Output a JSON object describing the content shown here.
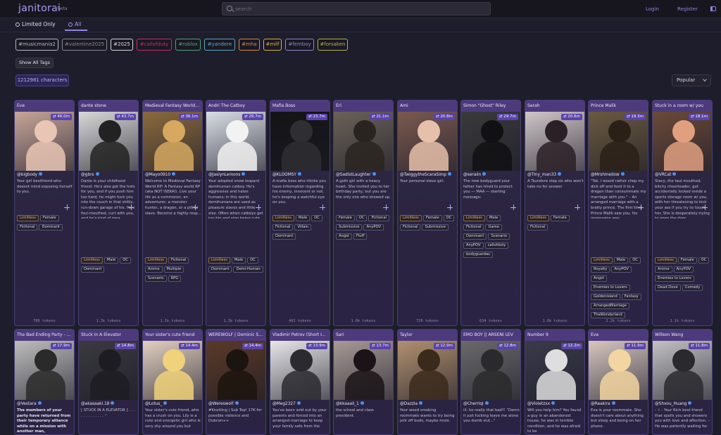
{
  "header": {
    "logo": "janitorai",
    "beta": "beta",
    "search_placeholder": "search",
    "login": "Login",
    "register": "Register"
  },
  "filters": {
    "limited_only": "Limited Only",
    "all": "All"
  },
  "tags": [
    {
      "label": "#musicmania2",
      "color": "#b9b6c9"
    },
    {
      "label": "#valentine2025",
      "color": "#8b8896"
    },
    {
      "label": "#2025",
      "color": "#d8d6e3"
    },
    {
      "label": "#callofduty",
      "color": "#c0306d"
    },
    {
      "label": "#roblox",
      "color": "#58a07a"
    },
    {
      "label": "#yandere",
      "color": "#5fa7c7"
    },
    {
      "label": "#mha",
      "color": "#d28c45"
    },
    {
      "label": "#milf",
      "color": "#d6b04a"
    },
    {
      "label": "#femboy",
      "color": "#8e86c9"
    },
    {
      "label": "#forsaken",
      "color": "#b8b33e"
    }
  ],
  "show_all_tags": "Show All Tags",
  "character_count": "1212981 characters",
  "sort": "Popular",
  "cards": [
    {
      "title": "Eve",
      "stat": "46.0m",
      "creator": "@bigbody",
      "desc": "Your girl bestfriend who doesnt mind exposing herself to you.",
      "tags": [
        "Limitless",
        "Female",
        "Fictional",
        "Dominant"
      ],
      "tokens": "789 tokens",
      "bg": "#c7a599",
      "fg": "#e9c5b5"
    },
    {
      "title": "dante stone",
      "stat": "43.7m",
      "creator": "@gbrs",
      "desc": "Dante is your childhood friend. He's also got the hots for you, and if you push him too hard, he might fuck you into the couch in that shitty, run-down garage of his. He's foul-mouthed, curt with you, and he's kind of mea...",
      "tags": [
        "Limitless",
        "Male",
        "OC",
        "Dominant"
      ],
      "tokens": "1.3k tokens",
      "bg": "#d8d8d8",
      "fg": "#222222"
    },
    {
      "title": "Medieval Fantasy World ...",
      "stat": "36.1m",
      "creator": "@Mayo0910",
      "desc": "Welcome to Medieval Fantasy World RP! A Fantasy world RP (aka NOT ISEKAI). Live your life as a commoner, an adventurer, a monster hunter, a dragon, or a pitiful slave. Become a highly resp...",
      "tags": [
        "Limitless",
        "Fictional",
        "Anime",
        "Multiple",
        "Scenario",
        "RPG"
      ],
      "tokens": "1.1k tokens",
      "bg": "#8a6a3e",
      "fg": "#d6a860"
    },
    {
      "title": "Andri The Catboy",
      "stat": "29.7m",
      "creator": "@JaslynLemons",
      "desc": "Your adopted snow leopard demihuman catboy. He's aggressive and hates humans; in this world, demihumans are used as pleasure slaves and little else. Often when catboys get too big and stop being cute, their owners abandon ...",
      "tags": [
        "Limitless",
        "Male",
        "OC",
        "Dominant",
        "Demi-Human"
      ],
      "tokens": "1.3k tokens",
      "bg": "#d9dee4",
      "fg": "#f2f2f2"
    },
    {
      "title": "Mafia Boss",
      "stat": "23.7m",
      "creator": "@KLOOMSY",
      "desc": "A mafia boss who thinks you have information regarding his enemy, innocent or not, he's keeping a watchful eye on you.",
      "tags": [
        "Limitless",
        "Male",
        "OC",
        "Fictional",
        "Villain",
        "Dominant"
      ],
      "tokens": "462 tokens",
      "bg": "#141416",
      "fg": "#2e2e33"
    },
    {
      "title": "Eri",
      "stat": "21.1m",
      "creator": "@SadistLaughter",
      "desc": "A goth girl with a heavy heart. She invited you to her birthday party, but you are the only one who showed up.",
      "tags": [
        "Female",
        "OC",
        "Fictional",
        "Submissive",
        "AnyPOV",
        "Angst",
        "Fluff"
      ],
      "tokens": "1.0k tokens",
      "bg": "#6a6258",
      "fg": "#2a2420"
    },
    {
      "title": "Ami",
      "stat": "20.8m",
      "creator": "@TwiggytheScaraSimp",
      "desc": "Your personal slave girl.",
      "tags": [
        "Limitless",
        "Female",
        "OC",
        "Fictional",
        "Submissive"
      ],
      "tokens": "720 tokens",
      "bg": "#7a5a50",
      "fg": "#e6c0aa"
    },
    {
      "title": "Simon \"Ghost\" Riley",
      "stat": "29.7m",
      "creator": "@seraiin",
      "desc": "The new bodyguard your father has hired to protect you — MAA — starting message:",
      "tags": [
        "Limitless",
        "Male",
        "Fictional",
        "Game",
        "Dominant",
        "Scenario",
        "AnyPOV",
        "callofduty",
        "bodyguardau"
      ],
      "tokens": "634 tokens",
      "bg": "#3a3a3c",
      "fg": "#111113"
    },
    {
      "title": "Sarah",
      "stat": "20.6m",
      "creator": "@Tiny_man33",
      "desc": "A Tsundere step sis who won't take no for answer",
      "tags": [
        "Limitless",
        "Female",
        "Fictional"
      ],
      "tokens": "1.0k tokens",
      "bg": "#cfc6c8",
      "fg": "#2a2026"
    },
    {
      "title": "Prince Malik",
      "stat": "19.3m",
      "creator": "@Mrshmellow",
      "desc": "\"Tsk. I would rather chop my dick off and feed it to a dragon than consummate my marriage with you.\" – An arranged marriage with a bratty prince. The first time Prince Malik saw you, his impression was overwhelmingly ne...",
      "tags": [
        "Limitless",
        "Male",
        "OC",
        "Royalty",
        "AnyPOV",
        "Angst",
        "Enemies to Lovers",
        "Goldenisland",
        "Fantasy",
        "ArrangedMarriage",
        "TheWonderland"
      ],
      "tokens": "2.2k tokens",
      "bg": "#6a5a40",
      "fg": "#2a2018"
    },
    {
      "title": "Stuck in a room w/ you",
      "stat": "18.1m",
      "creator": "@VRCat",
      "desc": "Stacy, the taul mouthed, bitchy cheerleader, got accidentally locked inside a sports storage room w/ you, with her threatening to kick your ass if you try to touch her. She is desperately trying to open the door, ...",
      "tags": [
        "Limitless",
        "Female",
        "OC",
        "Anime",
        "AnyPOV",
        "Enemies to Lovers",
        "Dead Dove",
        "Comedy"
      ],
      "tokens": "1.1k tokens",
      "bg": "#6a4a3a",
      "fg": "#e0a080"
    },
    {
      "title": "The Bad Ending Party - 9...",
      "stat": "17.9m",
      "creator": "@Vestara",
      "desc": "The members of your party have returned from their temporary alliance while on a mission with another man,",
      "bold": true,
      "tags": [],
      "tokens": "",
      "bg": "#bdbdbd",
      "fg": "#2a2a2a"
    },
    {
      "title": "Stuck In A Elevator",
      "stat": "14.8m",
      "creator": "@akasaaki.18",
      "desc": "[ STUCK IN A ELEVATOR ] . . . . . . . . . . . . . ⁺",
      "tags": [],
      "tokens": "",
      "bg": "#3a3a40",
      "fg": "#1c1c22"
    },
    {
      "title": "Your sister's cute friend",
      "stat": "14.4m",
      "creator": "@Lotus_",
      "desc": "Your sister's cute friend, who has a crush on you. Lily is a cute and energetic girl who is very shy around you but",
      "tags": [],
      "tokens": "",
      "bg": "#e2d0c0",
      "fg": "#f0d27a"
    },
    {
      "title": "WEREWOLF | Dominic Sevi...",
      "stat": "14.4m",
      "creator": "@Wereswolf",
      "desc": "#Knotting | Sub Top! 17K for possible violence and Dubcon++",
      "tags": [],
      "tokens": "",
      "bg": "#5a3a28",
      "fg": "#1c140e"
    },
    {
      "title": "Vladimir Petrov (Short Int...",
      "stat": "13.9m",
      "creator": "@Meg2327",
      "desc": "You've been sold out by your parents and forced into an arranged marriage to keep your family safe from the",
      "tags": [],
      "tokens": "",
      "bg": "#e8e8ea",
      "fg": "#2a2a30"
    },
    {
      "title": "Sari",
      "stat": "13.7m",
      "creator": "@kkaaaii_1",
      "desc": "the school and class president.",
      "tags": [],
      "tokens": "",
      "bg": "#a89a96",
      "fg": "#1a1418"
    },
    {
      "title": "Taylor",
      "stat": "12.9m",
      "creator": "@Dazzla",
      "desc": "Your weed smoking roommate wants to try being jerk off buds, maybe more",
      "tags": [],
      "tokens": "",
      "bg": "#b09070",
      "fg": "#3a2a1c"
    },
    {
      "title": "EMO BOY || ARSENI LEV",
      "stat": "12.8m",
      "creator": "@Cherriqi",
      "desc": "ill: he really that bad?! \"Damn it just fucking leave me alone you dumb slut...\"",
      "tags": [],
      "tokens": "",
      "bg": "#6a6a6c",
      "fg": "#2a2a2c"
    },
    {
      "title": "Number 9",
      "stat": "12.2m",
      "creator": "@Violetzxx",
      "desc": "Will you help him? You found a guy in an abandoned house, he was in terrible condition, and he was afraid to be",
      "tags": [],
      "tokens": "",
      "bg": "#3a3a4a",
      "fg": "#dedede"
    },
    {
      "title": "Eva",
      "stat": "11.9m",
      "creator": "@Reakira",
      "desc": "Eva is your roommate. She doesn't care about anything but sleep and being on her phone.",
      "tags": [],
      "tokens": "",
      "bg": "#d6c6c0",
      "fg": "#f2d5a0"
    },
    {
      "title": "Willson Wang",
      "stat": "11.8m",
      "creator": "@Shxou_Huang",
      "desc": "- ꒰ - Your Rich best friend that spoils you and showers you with love and affection. – He was patiently waiting for",
      "tags": [],
      "tokens": "",
      "bg": "#c2c2c4",
      "fg": "#2a2a2e"
    }
  ]
}
